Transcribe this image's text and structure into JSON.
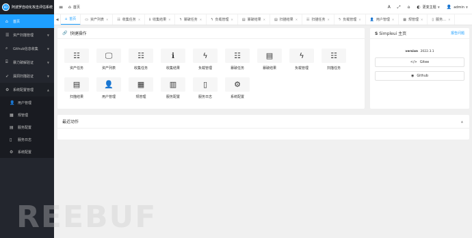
{
  "brand": {
    "logo": "BD",
    "title": "阿波罗自动化攻击评估系统"
  },
  "sidebar": {
    "items": [
      {
        "label": "首页",
        "icon": "home-icon",
        "glyph": "⌂",
        "active": true
      },
      {
        "label": "资产扫描管理",
        "icon": "list-icon",
        "glyph": "☰"
      },
      {
        "label": "Github信息收集",
        "icon": "search-icon",
        "glyph": "⌕"
      },
      {
        "label": "暴力破解验证",
        "icon": "bank-icon",
        "glyph": "⌸"
      },
      {
        "label": "漏洞扫描验证",
        "icon": "rocket-icon",
        "glyph": "➶"
      },
      {
        "label": "系统配置管理",
        "icon": "gear-icon",
        "glyph": "⚙"
      }
    ],
    "sub_items": [
      {
        "label": "用户管理",
        "icon": "user-icon",
        "glyph": "👤"
      },
      {
        "label": "规管理",
        "icon": "table-icon",
        "glyph": "▦"
      },
      {
        "label": "服务配置",
        "icon": "map-icon",
        "glyph": "▤"
      },
      {
        "label": "服务日志",
        "icon": "file-icon",
        "glyph": "▯"
      },
      {
        "label": "系统配置",
        "icon": "gear-icon",
        "glyph": "⚙"
      }
    ]
  },
  "header": {
    "breadcrumb": "首页",
    "font_btn": "A",
    "fullscreen_btn": "⤢",
    "home_btn": "⌂",
    "theme_label": "更变主题",
    "user_label": "admin"
  },
  "tabs": [
    {
      "label": "首页",
      "glyph": "⌂",
      "active": true
    },
    {
      "label": "资产列表",
      "glyph": "▭"
    },
    {
      "label": "收集任务",
      "glyph": "☷"
    },
    {
      "label": "收集结果",
      "glyph": "ℹ"
    },
    {
      "label": "暴破任务",
      "glyph": "ϟ"
    },
    {
      "label": "负载管理",
      "glyph": "ϟ"
    },
    {
      "label": "暴破结果",
      "glyph": "▤"
    },
    {
      "label": "扫描结果",
      "glyph": "▤"
    },
    {
      "label": "扫描任务",
      "glyph": "☷"
    },
    {
      "label": "负载管理",
      "glyph": "ϟ"
    },
    {
      "label": "用户管理",
      "glyph": "👤"
    },
    {
      "label": "规管理",
      "glyph": "▦"
    },
    {
      "label": "服务…",
      "glyph": "▯"
    }
  ],
  "quick": {
    "title": "快捷操作",
    "tiles": [
      {
        "label": "资产任务",
        "icon": "tasks-icon",
        "glyph": "☷"
      },
      {
        "label": "资产列表",
        "icon": "monitor-icon",
        "glyph": "🖵"
      },
      {
        "label": "收集任务",
        "icon": "tasks-icon",
        "glyph": "☷"
      },
      {
        "label": "收集结果",
        "icon": "info-icon",
        "glyph": "ℹ"
      },
      {
        "label": "负载管理",
        "icon": "bolt-icon",
        "glyph": "ϟ"
      },
      {
        "label": "暴破任务",
        "icon": "tasks-icon",
        "glyph": "☷"
      },
      {
        "label": "暴破结果",
        "icon": "server-icon",
        "glyph": "▤"
      },
      {
        "label": "负载管理",
        "icon": "bolt-icon",
        "glyph": "ϟ"
      },
      {
        "label": "扫描任务",
        "icon": "tasks-icon",
        "glyph": "☷"
      },
      {
        "label": "扫描结果",
        "icon": "server-icon",
        "glyph": "▤"
      },
      {
        "label": "用户管理",
        "icon": "user-icon",
        "glyph": "👤"
      },
      {
        "label": "规管理",
        "icon": "table-icon",
        "glyph": "▦"
      },
      {
        "label": "服务配置",
        "icon": "map-icon",
        "glyph": "▥"
      },
      {
        "label": "服务日志",
        "icon": "file-icon",
        "glyph": "▯"
      },
      {
        "label": "系统配置",
        "icon": "gear-icon",
        "glyph": "⚙"
      }
    ]
  },
  "info": {
    "title": "Simpleui 主页",
    "report_link": "报告问题",
    "version_label": "version",
    "version_value": "2022.3.1",
    "gitee_label": "Gitee",
    "github_label": "Github"
  },
  "recent": {
    "title": "最近动作"
  },
  "watermark": "REEBUF",
  "colors": {
    "accent": "#1e9fff",
    "sidebar_bg": "#23262e"
  }
}
